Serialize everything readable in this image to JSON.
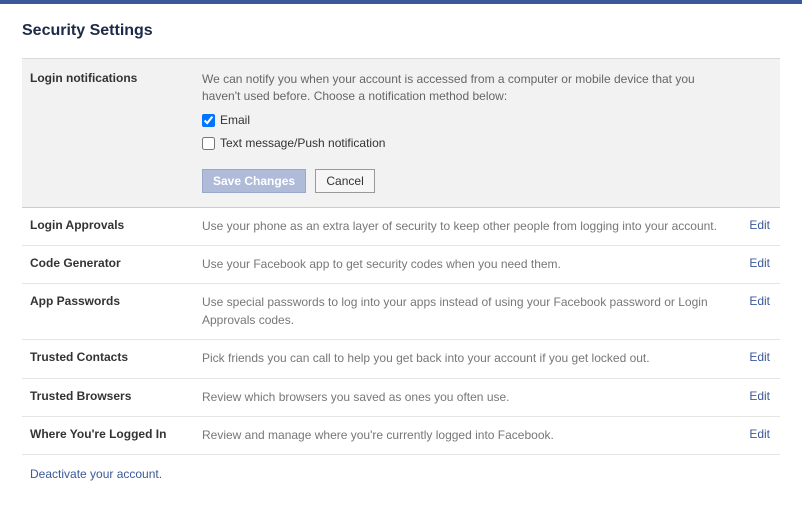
{
  "page_title": "Security Settings",
  "login_notifications": {
    "label": "Login notifications",
    "description": "We can notify you when your account is accessed from a computer or mobile device that you haven't used before. Choose a notification method below:",
    "options": {
      "email": {
        "label": "Email",
        "checked": true
      },
      "text": {
        "label": "Text message/Push notification",
        "checked": false
      }
    },
    "save_label": "Save Changes",
    "cancel_label": "Cancel"
  },
  "rows": [
    {
      "label": "Login Approvals",
      "desc": "Use your phone as an extra layer of security to keep other people from logging into your account.",
      "action": "Edit"
    },
    {
      "label": "Code Generator",
      "desc": "Use your Facebook app to get security codes when you need them.",
      "action": "Edit"
    },
    {
      "label": "App Passwords",
      "desc": "Use special passwords to log into your apps instead of using your Facebook password or Login Approvals codes.",
      "action": "Edit"
    },
    {
      "label": "Trusted Contacts",
      "desc": "Pick friends you can call to help you get back into your account if you get locked out.",
      "action": "Edit"
    },
    {
      "label": "Trusted Browsers",
      "desc": "Review which browsers you saved as ones you often use.",
      "action": "Edit"
    },
    {
      "label": "Where You're Logged In",
      "desc": "Review and manage where you're currently logged into Facebook.",
      "action": "Edit"
    }
  ],
  "deactivate_label": "Deactivate your account."
}
